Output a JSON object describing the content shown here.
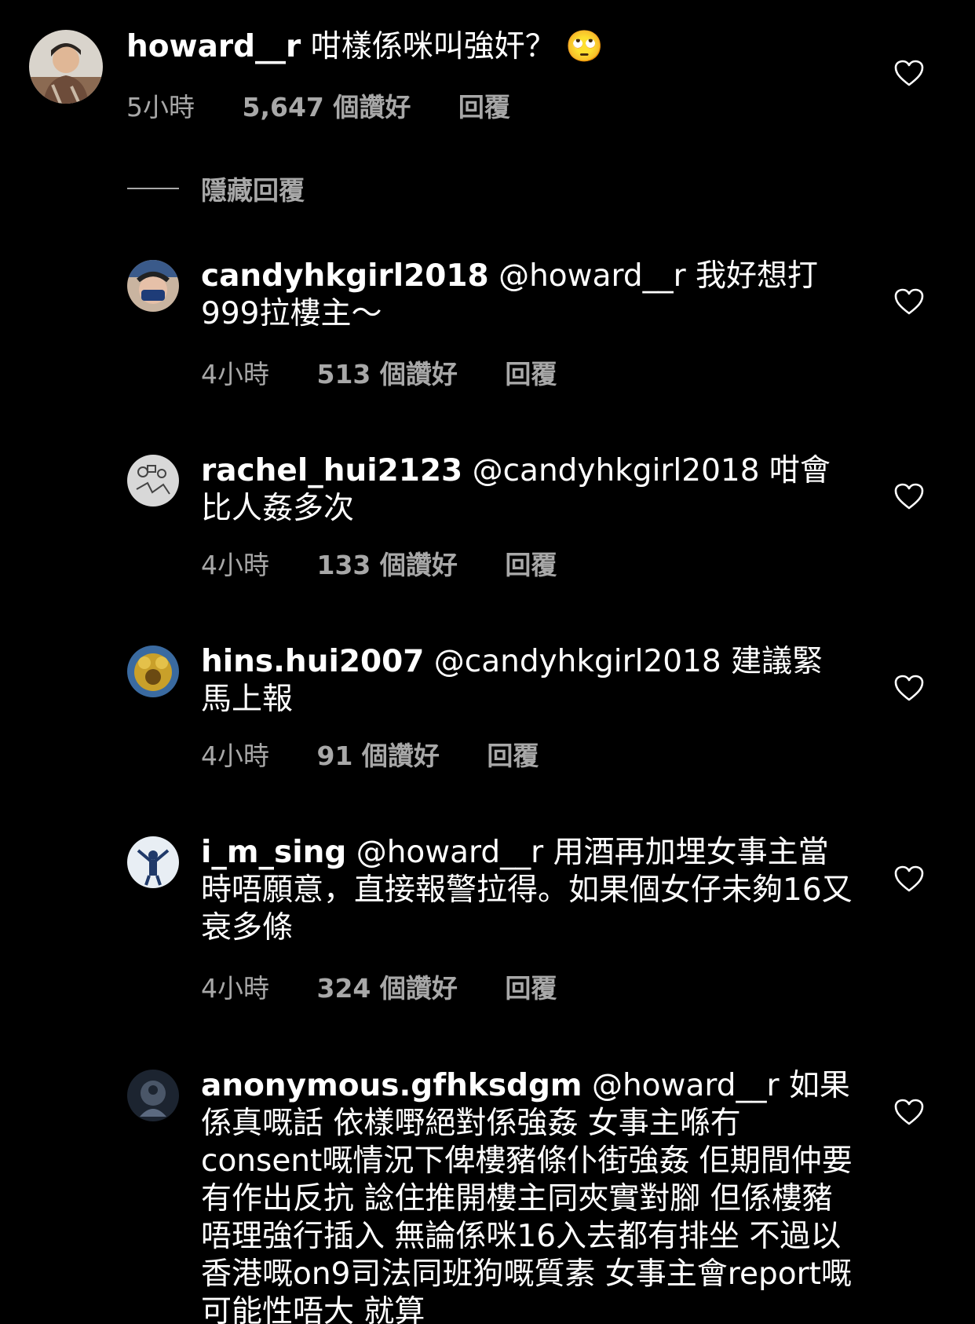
{
  "comments": [
    {
      "username": "howard__r",
      "text": "咁樣係咪叫強奸？",
      "emoji": "🙄",
      "time": "5小時",
      "likes": "5,647 個讚好",
      "reply": "回覆",
      "avatar_icon": "person-photo-avatar"
    },
    {
      "username": "candyhkgirl2018",
      "text": "@howard__r 我好想打999拉樓主～",
      "time": "4小時",
      "likes": "513 個讚好",
      "reply": "回覆",
      "avatar_icon": "masked-face-avatar"
    },
    {
      "username": "rachel_hui2123",
      "text": "@candyhkgirl2018 咁會比人姦多次",
      "time": "4小時",
      "likes": "133 個讚好",
      "reply": "回覆",
      "avatar_icon": "doodle-avatar"
    },
    {
      "username": "hins.hui2007",
      "text": "@candyhkgirl2018 建議緊馬上報",
      "time": "4小時",
      "likes": "91 個讚好",
      "reply": "回覆",
      "avatar_icon": "gold-figure-avatar"
    },
    {
      "username": "i_m_sing",
      "text": "@howard__r 用酒再加埋女事主當時唔願意，直接報警拉得。如果個女仔未夠16又衰多條",
      "time": "4小時",
      "likes": "324 個讚好",
      "reply": "回覆",
      "avatar_icon": "sky-person-avatar"
    },
    {
      "username": "anonymous.gfhksdgm",
      "text": "@howard__r 如果係真嘅話 依樣嘢絕對係強姦 女事主喺冇consent嘅情況下俾樓豬條仆街強姦 佢期間仲要有作出反抗 諗住推開樓主同夾實對腳 但係樓豬唔理強行插入 無論係咪16入去都有排坐 不過以香港嘅on9司法同班狗嘅質素 女事主會report嘅可能性唔大 就算",
      "time": "",
      "likes": "",
      "reply": "",
      "avatar_icon": "dark-figure-avatar"
    }
  ],
  "hide_replies": "隱藏回覆",
  "colors": {
    "background": "#000000",
    "text": "#ffffff",
    "secondary": "#a8a8a8"
  }
}
